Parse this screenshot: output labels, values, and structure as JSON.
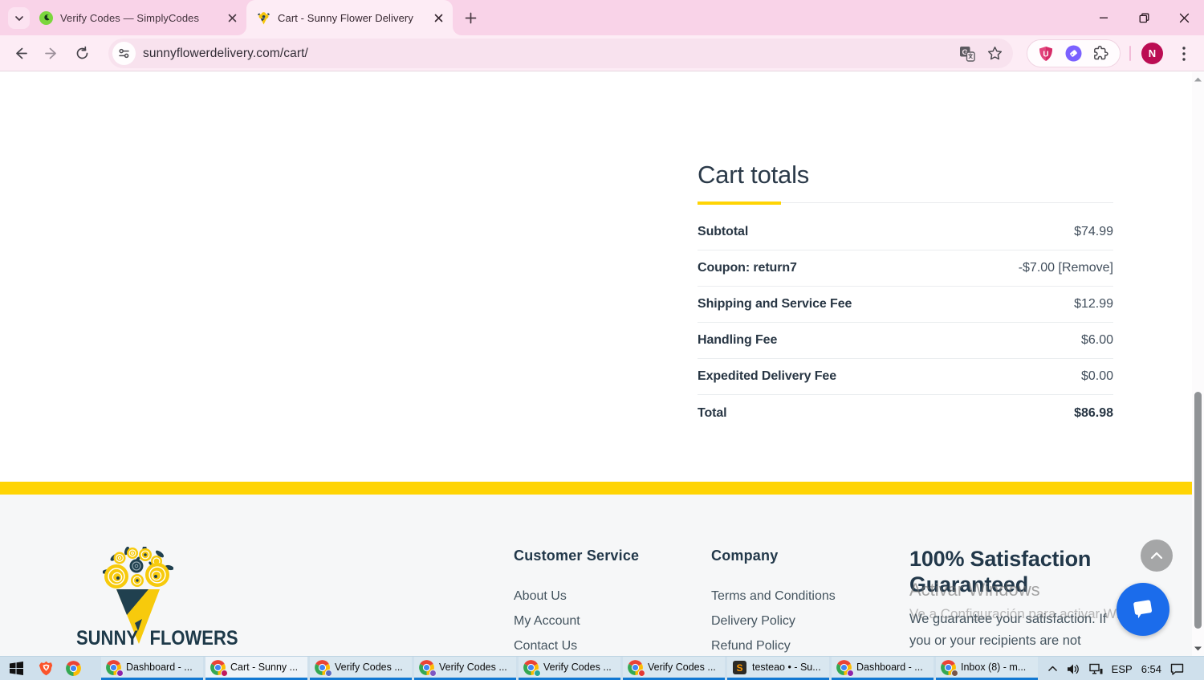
{
  "browser": {
    "tab_search_tooltip": "tab-search",
    "tabs": [
      {
        "title": "Verify Codes — SimplyCodes",
        "active": false
      },
      {
        "title": "Cart - Sunny Flower Delivery",
        "active": true
      }
    ],
    "url": "sunnyflowerdelivery.com/cart/",
    "profile_initial": "N",
    "extensions": [
      "ublock",
      "simplycodes",
      "puzzle"
    ]
  },
  "page": {
    "cart": {
      "title": "Cart totals",
      "rows": [
        {
          "label": "Subtotal",
          "value": "$74.99"
        },
        {
          "label": "Coupon: return7",
          "value": "-$7.00",
          "action": "[Remove]"
        },
        {
          "label": "Shipping and Service Fee",
          "value": "$12.99"
        },
        {
          "label": "Handling Fee",
          "value": "$6.00"
        },
        {
          "label": "Expedited Delivery Fee",
          "value": "$0.00"
        },
        {
          "label": "Total",
          "value": "$86.98"
        }
      ]
    },
    "footer": {
      "logo_word1": "SUNNY",
      "logo_word2": "FLOWERS",
      "columns": [
        {
          "heading": "Customer Service",
          "links": [
            "About Us",
            "My Account",
            "Contact Us"
          ]
        },
        {
          "heading": "Company",
          "links": [
            "Terms and Conditions",
            "Delivery Policy",
            "Refund Policy"
          ]
        }
      ],
      "satisfaction": {
        "heading": "100% Satisfaction Guaranteed",
        "text": "We guarantee your satisfaction. If you or your recipients are not"
      }
    },
    "watermark": {
      "line1": "Activar Windows",
      "line2": "Ve a Configuración para activar Windows."
    }
  },
  "taskbar": {
    "buttons": [
      {
        "label": "Dashboard - ...",
        "app": "chrome",
        "badge": "#8e24aa",
        "active": false
      },
      {
        "label": "Cart - Sunny ...",
        "app": "chrome",
        "badge": "#c2185b",
        "active": true
      },
      {
        "label": "Verify Codes ...",
        "app": "chrome",
        "badge": "#5c6bc0",
        "active": false
      },
      {
        "label": "Verify Codes ...",
        "app": "chrome",
        "badge": "#7e57c2",
        "active": false
      },
      {
        "label": "Verify Codes ...",
        "app": "chrome",
        "badge": "#26a69a",
        "active": false
      },
      {
        "label": "Verify Codes ...",
        "app": "chrome",
        "badge": "#e53935",
        "active": false
      },
      {
        "label": "testeao • - Su...",
        "app": "sublime",
        "badge": null,
        "active": false
      },
      {
        "label": "Dashboard - ...",
        "app": "chrome",
        "badge": "#8e24aa",
        "active": false
      },
      {
        "label": "Inbox (8) - m...",
        "app": "chrome",
        "badge": "#795548",
        "active": false
      }
    ],
    "tray": {
      "language": "ESP",
      "time": "6:54"
    }
  },
  "colors": {
    "accent_yellow": "#ffd404",
    "chrome_theme_pink": "#f9d3e8",
    "toolbar_pink": "#fdecf5",
    "taskbar_blue": "#cfe0ec",
    "taskbar_indicator": "#1278d2",
    "chat_blue": "#1b6ceb",
    "heading_navy": "#22384a",
    "footer_bg": "#f6f7f8"
  }
}
